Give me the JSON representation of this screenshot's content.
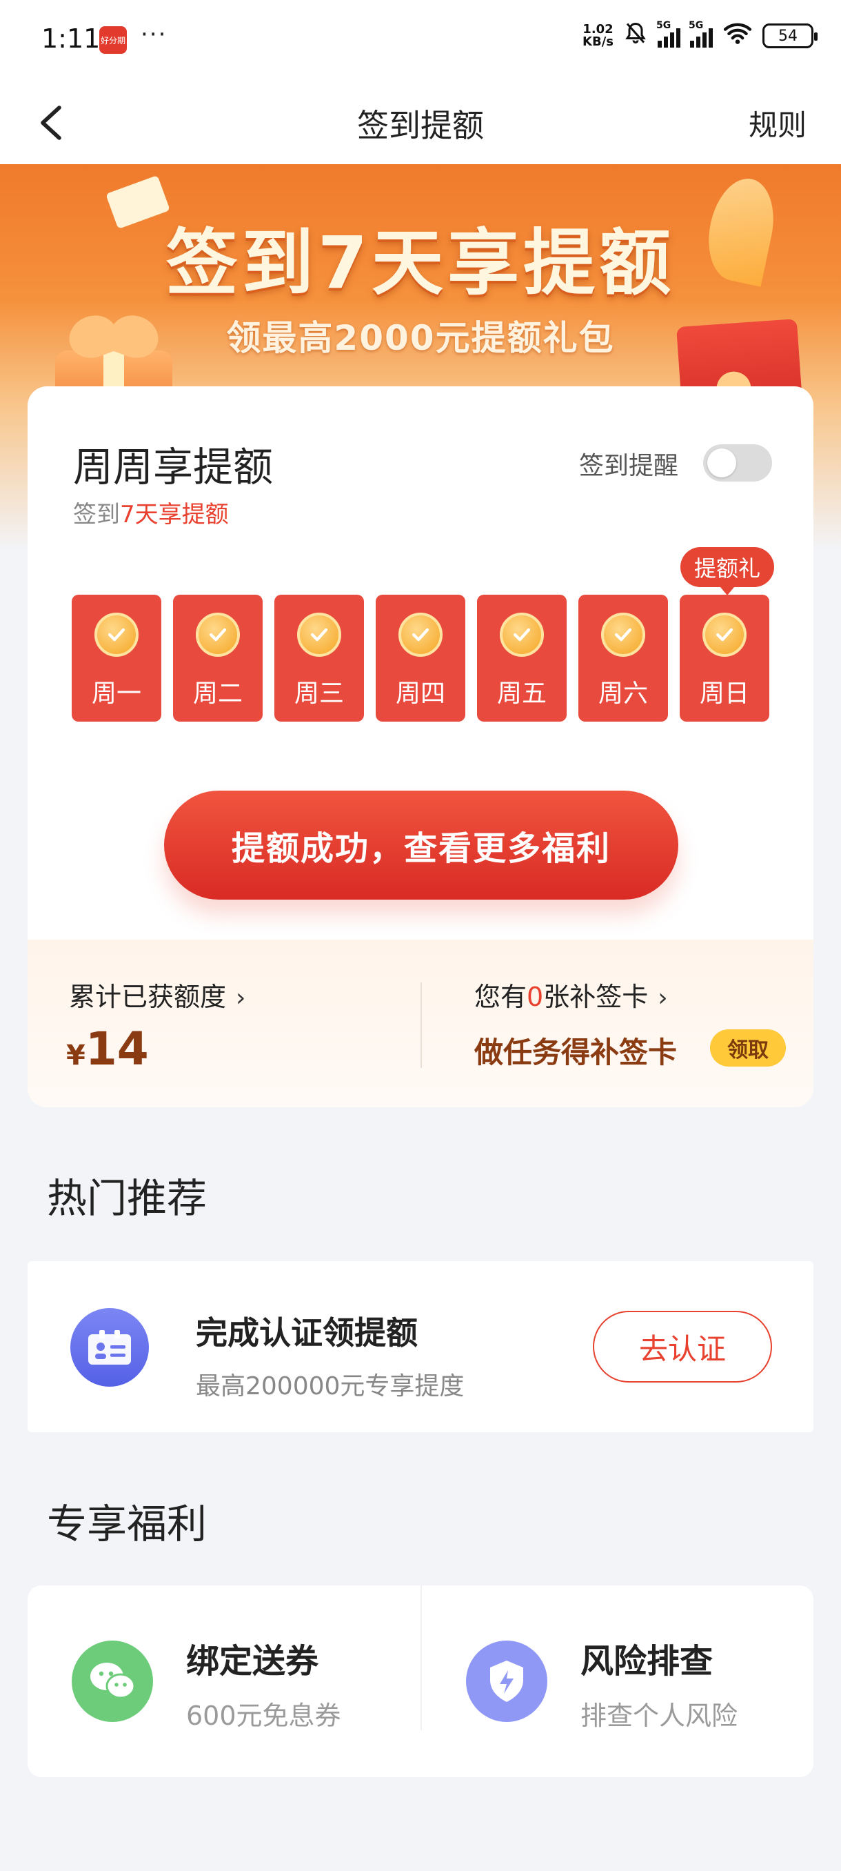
{
  "status_bar": {
    "time": "1:11",
    "app_badge": "好分期",
    "more": "···",
    "net_speed_value": "1.02",
    "net_speed_unit": "KB/s",
    "network_1": "5G",
    "network_2": "5G",
    "battery": "54"
  },
  "nav": {
    "title": "签到提额",
    "rules_label": "规则"
  },
  "banner": {
    "title": "签到7天享提额",
    "subtitle": "领最高2000元提额礼包"
  },
  "sign_card": {
    "title": "周周享提额",
    "subtitle_prefix": "签到",
    "subtitle_highlight": "7天享提额",
    "remind_label": "签到提醒",
    "remind_enabled": false,
    "gift_tag": "提额礼",
    "days": [
      {
        "label": "周一",
        "checked": true
      },
      {
        "label": "周二",
        "checked": true
      },
      {
        "label": "周三",
        "checked": true
      },
      {
        "label": "周四",
        "checked": true
      },
      {
        "label": "周五",
        "checked": true
      },
      {
        "label": "周六",
        "checked": true
      },
      {
        "label": "周日",
        "checked": true
      }
    ],
    "cta_label": "提额成功，查看更多福利",
    "accent_color": "#e94a3e"
  },
  "stats": {
    "total_label": "累计已获额度",
    "currency": "¥",
    "amount": "14",
    "cards_prefix": "您有",
    "cards_count": "0",
    "cards_suffix": "张补签卡",
    "task_text": "做任务得补签卡",
    "claim_label": "领取"
  },
  "hot_recommend": {
    "section_title": "热门推荐",
    "item": {
      "title": "完成认证领提额",
      "desc": "最高200000元专享提度",
      "button": "去认证",
      "icon": "id-card-icon"
    }
  },
  "exclusive": {
    "section_title": "专享福利",
    "items": [
      {
        "title": "绑定送券",
        "desc": "600元免息券",
        "icon": "wechat-icon",
        "color": "#6ccc7a"
      },
      {
        "title": "风险排查",
        "desc": "排查个人风险",
        "icon": "shield-icon",
        "color": "#8f98f5"
      }
    ]
  }
}
